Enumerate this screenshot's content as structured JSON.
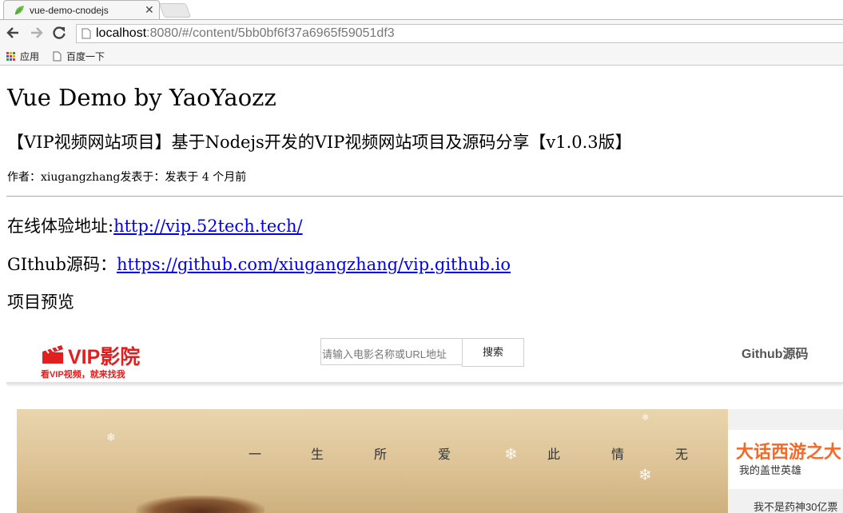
{
  "browser": {
    "tab_title": "vue-demo-cnodejs",
    "url_host": "localhost",
    "url_rest": ":8080/#/content/5bb0bf6f37a6965f59051df3",
    "bookmarks": [
      {
        "label": "应用",
        "icon": "apps-grid-icon"
      },
      {
        "label": "百度一下",
        "icon": "page-icon"
      }
    ]
  },
  "page": {
    "site_title": "Vue Demo by YaoYaozz",
    "topic_title": "【VIP视频网站项目】基于Nodejs开发的VIP视频网站项目及源码分享【v1.0.3版】",
    "meta": "作者：xiugangzhang发表于：发表于 4 个月前",
    "demo_label": "在线体验地址:",
    "demo_link": "http://vip.52tech.tech/",
    "github_label": "GIthub源码：",
    "github_link": "https://github.com/xiugangzhang/vip.github.io",
    "preview_heading": "项目预览"
  },
  "preview": {
    "logo_name": "VIP影院",
    "logo_slogan": "看VIP视频，就来找我",
    "search_placeholder": "请输入电影名称或URL地址",
    "search_button": "搜索",
    "github_nav": "Github源码",
    "poem_chars": [
      "一",
      "生",
      "所",
      "爱",
      "此",
      "情",
      "无"
    ],
    "side_title": "大话西游之大",
    "side_subtitle": "我的盖世英雄",
    "side_item": "我不是药神30亿票"
  },
  "colors": {
    "accent_red": "#e02020",
    "link_blue": "#0000ee",
    "side_orange": "#f26a2a"
  }
}
